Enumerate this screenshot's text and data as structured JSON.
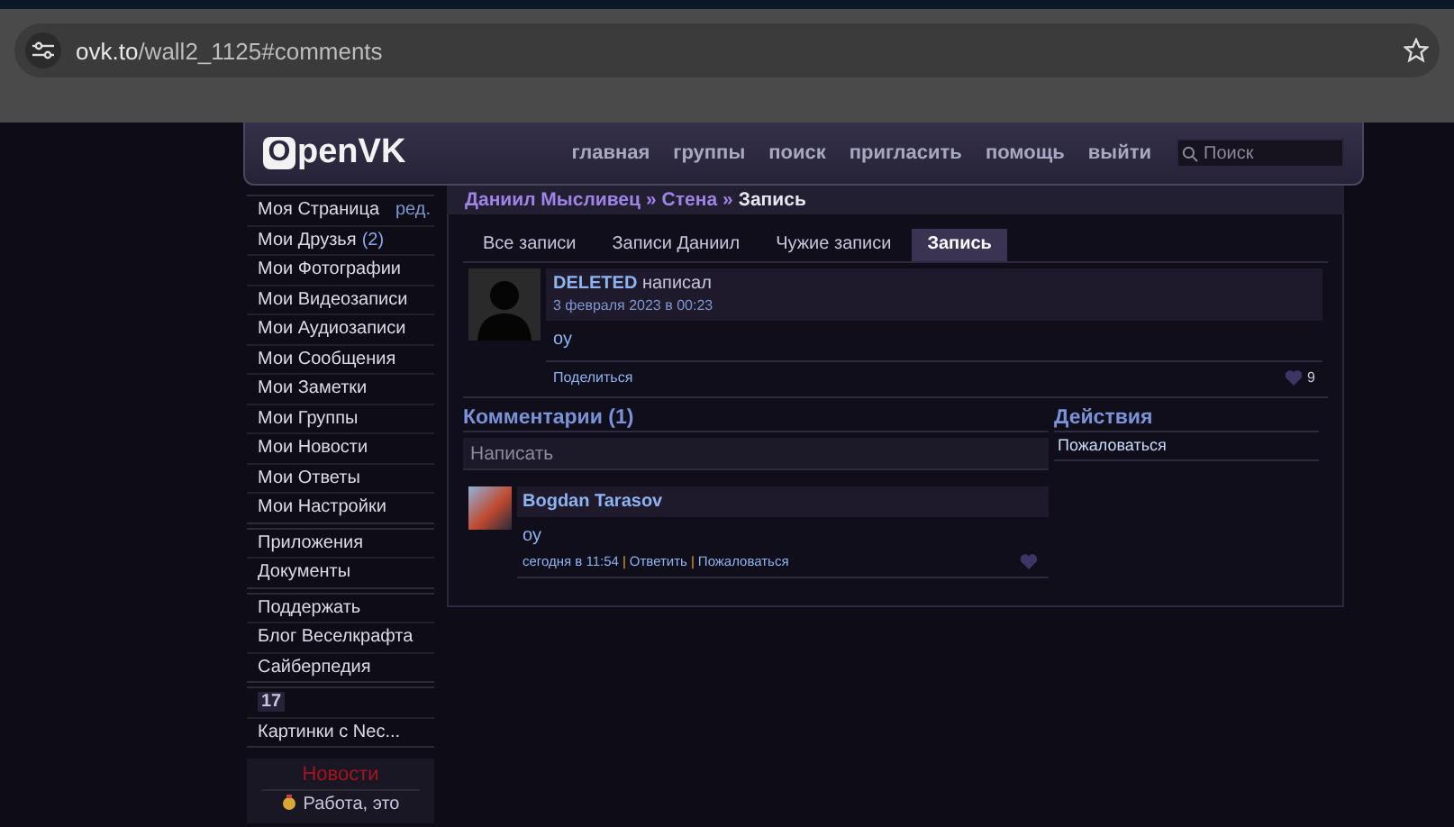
{
  "browser": {
    "url_host": "ovk.to",
    "url_path": "/wall2_1125#comments"
  },
  "header": {
    "logo": "OpenVK",
    "nav": [
      "главная",
      "группы",
      "поиск",
      "пригласить",
      "помощь",
      "выйти"
    ],
    "search": {
      "placeholder": "Поиск"
    }
  },
  "sidebar": {
    "groups": [
      [
        {
          "kind": "link",
          "label": "Моя Страница",
          "extra": "ред."
        },
        {
          "kind": "count",
          "label": "Мои Друзья",
          "extra": "(2)"
        },
        {
          "kind": "link",
          "label": "Мои Фотографии"
        },
        {
          "kind": "link",
          "label": "Мои Видеозаписи"
        },
        {
          "kind": "link",
          "label": "Мои Аудиозаписи"
        },
        {
          "kind": "link",
          "label": "Мои Сообщения"
        },
        {
          "kind": "link",
          "label": "Мои Заметки"
        },
        {
          "kind": "link",
          "label": "Мои Группы"
        },
        {
          "kind": "link",
          "label": "Мои Новости"
        },
        {
          "kind": "link",
          "label": "Мои Ответы"
        },
        {
          "kind": "link",
          "label": "Мои Настройки"
        }
      ],
      [
        {
          "kind": "link",
          "label": "Приложения"
        },
        {
          "kind": "link",
          "label": "Документы"
        }
      ],
      [
        {
          "kind": "link",
          "label": "Поддержать"
        },
        {
          "kind": "link",
          "label": "Блог Веселкрафта"
        },
        {
          "kind": "link",
          "label": "Сайберпедия"
        }
      ],
      [
        {
          "kind": "badge",
          "label": "17"
        },
        {
          "kind": "link",
          "label": "Картинки с Nec..."
        }
      ]
    ],
    "news": {
      "title": "Новости",
      "item": "Работа, это"
    }
  },
  "breadcrumbs": [
    {
      "label": "Даниил Мысливец",
      "current": false
    },
    {
      "separator": "»",
      "label": "Стена",
      "current": false
    },
    {
      "separator": "»",
      "label": "Запись",
      "current": true
    }
  ],
  "tabs": [
    {
      "label": "Все записи",
      "selected": false
    },
    {
      "label": "Записи Даниил",
      "selected": false
    },
    {
      "label": "Чужие записи",
      "selected": false
    },
    {
      "label": "Запись",
      "selected": true
    }
  ],
  "post": {
    "author": "DELETED",
    "action": "написал",
    "date": "3 февраля 2023 в 00:23",
    "text": "оу",
    "share": "Поделиться",
    "likes": "9"
  },
  "comments": {
    "title": "Комментарии (1)",
    "input": {
      "placeholder": "Написать"
    },
    "items": [
      {
        "author": "Bogdan Tarasov",
        "text": "оу",
        "time": "сегодня в 11:54",
        "divider": "|",
        "reply": "Ответить",
        "report": "Пожаловаться"
      }
    ]
  },
  "actions": {
    "title": "Действия",
    "items": [
      "Пожаловаться"
    ]
  }
}
